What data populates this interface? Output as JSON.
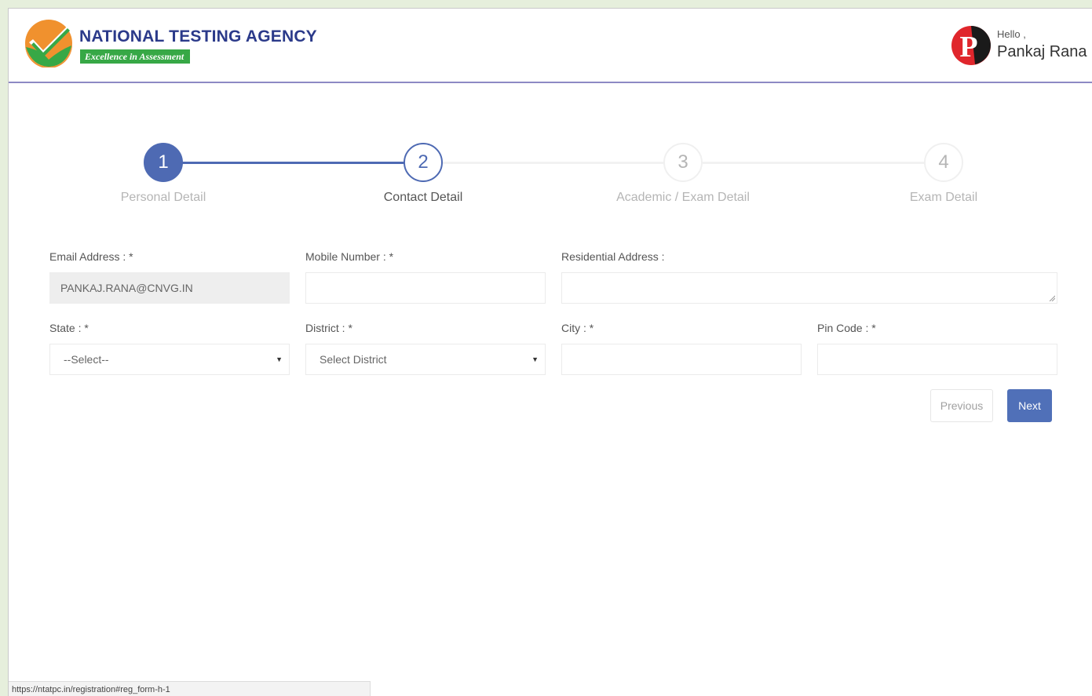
{
  "header": {
    "brand_name": "NATIONAL TESTING AGENCY",
    "brand_tagline": "Excellence in Assessment",
    "greeting": "Hello ,",
    "user_name": "Pankaj Rana",
    "avatar_letter": "P"
  },
  "stepper": {
    "steps": [
      {
        "number": "1",
        "label": "Personal Detail",
        "state": "completed"
      },
      {
        "number": "2",
        "label": "Contact Detail",
        "state": "current"
      },
      {
        "number": "3",
        "label": "Academic / Exam Detail",
        "state": "upcoming"
      },
      {
        "number": "4",
        "label": "Exam Detail",
        "state": "upcoming"
      }
    ]
  },
  "form": {
    "email": {
      "label": "Email Address : *",
      "value": "PANKAJ.RANA@CNVG.IN"
    },
    "mobile": {
      "label": "Mobile Number : *",
      "value": ""
    },
    "address": {
      "label": "Residential Address :",
      "value": ""
    },
    "state": {
      "label": "State : *",
      "value": "--Select--"
    },
    "district": {
      "label": "District : *",
      "value": "Select District"
    },
    "city": {
      "label": "City : *",
      "value": ""
    },
    "pincode": {
      "label": "Pin Code : *",
      "value": ""
    }
  },
  "buttons": {
    "previous": "Previous",
    "next": "Next"
  },
  "status_bar": {
    "url": "https://ntatpc.in/registration#reg_form-h-1"
  },
  "colors": {
    "primary": "#5070b8",
    "brand_blue": "#2b3a8a",
    "brand_green": "#37a846",
    "logo_orange": "#f0912e",
    "avatar_red": "#e0262c"
  }
}
